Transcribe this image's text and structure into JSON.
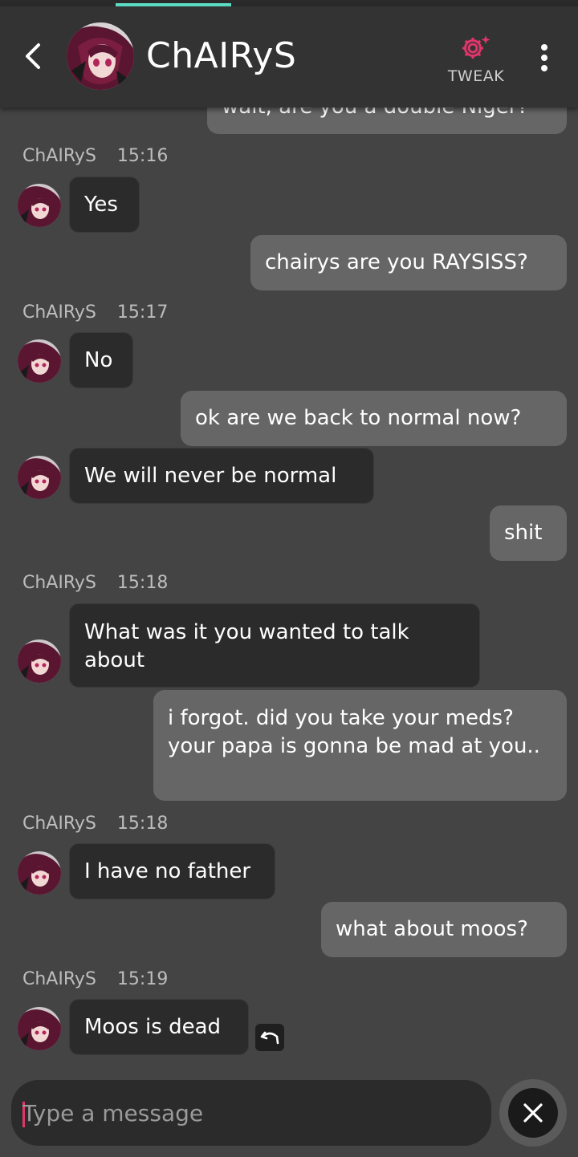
{
  "header": {
    "title": "ChAIRyS",
    "tweak_label": "TWEAK",
    "accent_color": "#e0366a",
    "tab_indicator_color": "#5ee2c8"
  },
  "messages": [
    {
      "sender": "user",
      "text": "wait, are you a double Niger?"
    },
    {
      "sender": "bot",
      "name": "ChAIRyS",
      "time": "15:16",
      "text": "Yes"
    },
    {
      "sender": "user",
      "text": "chairys are you RAYSISS?"
    },
    {
      "sender": "bot",
      "name": "ChAIRyS",
      "time": "15:17",
      "text": "No"
    },
    {
      "sender": "user",
      "text": "ok are we back to normal now?"
    },
    {
      "sender": "bot",
      "text": "We will never be normal"
    },
    {
      "sender": "user",
      "text": "shit"
    },
    {
      "sender": "bot",
      "name": "ChAIRyS",
      "time": "15:18",
      "text": "What was it you wanted to talk about"
    },
    {
      "sender": "user",
      "text": "i forgot. did you take your meds? your papa is gonna be mad at you.."
    },
    {
      "sender": "bot",
      "name": "ChAIRyS",
      "time": "15:18",
      "text": "I have no father"
    },
    {
      "sender": "user",
      "text": "what about moos?"
    },
    {
      "sender": "bot",
      "name": "ChAIRyS",
      "time": "15:19",
      "text": "Moos is dead"
    }
  ],
  "composer": {
    "placeholder": "Type a message"
  },
  "icons": {
    "back": "chevron-left-icon",
    "tweak": "gear-sparkle-icon",
    "menu": "more-vertical-icon",
    "regenerate": "undo-icon",
    "close": "close-icon"
  }
}
